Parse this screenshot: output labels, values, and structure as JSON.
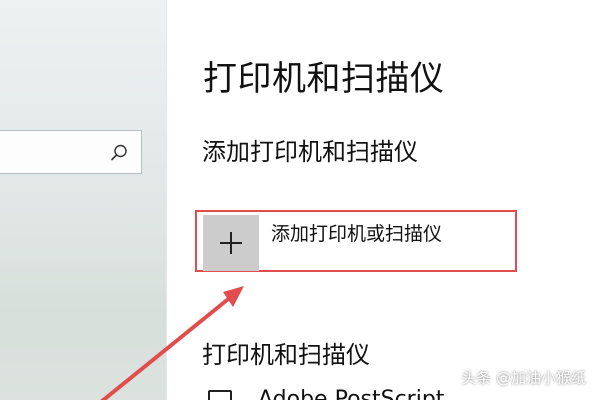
{
  "settings_page": {
    "title": "打印机和扫描仪",
    "add_section_heading": "添加打印机和扫描仪",
    "add_device_label": "添加打印机或扫描仪",
    "add_device_icon": "plus-icon",
    "list_heading": "打印机和扫描仪",
    "printers": [
      {
        "name": "Adobe PostScript",
        "icon": "printer-icon"
      }
    ]
  },
  "sidebar": {
    "search": {
      "value": "",
      "placeholder": "",
      "icon": "search-icon"
    }
  },
  "annotation": {
    "highlight_color": "#e14d4d",
    "arrow_color": "#e14d4d"
  },
  "watermark": {
    "text": "头条 @加油小猴纸"
  }
}
